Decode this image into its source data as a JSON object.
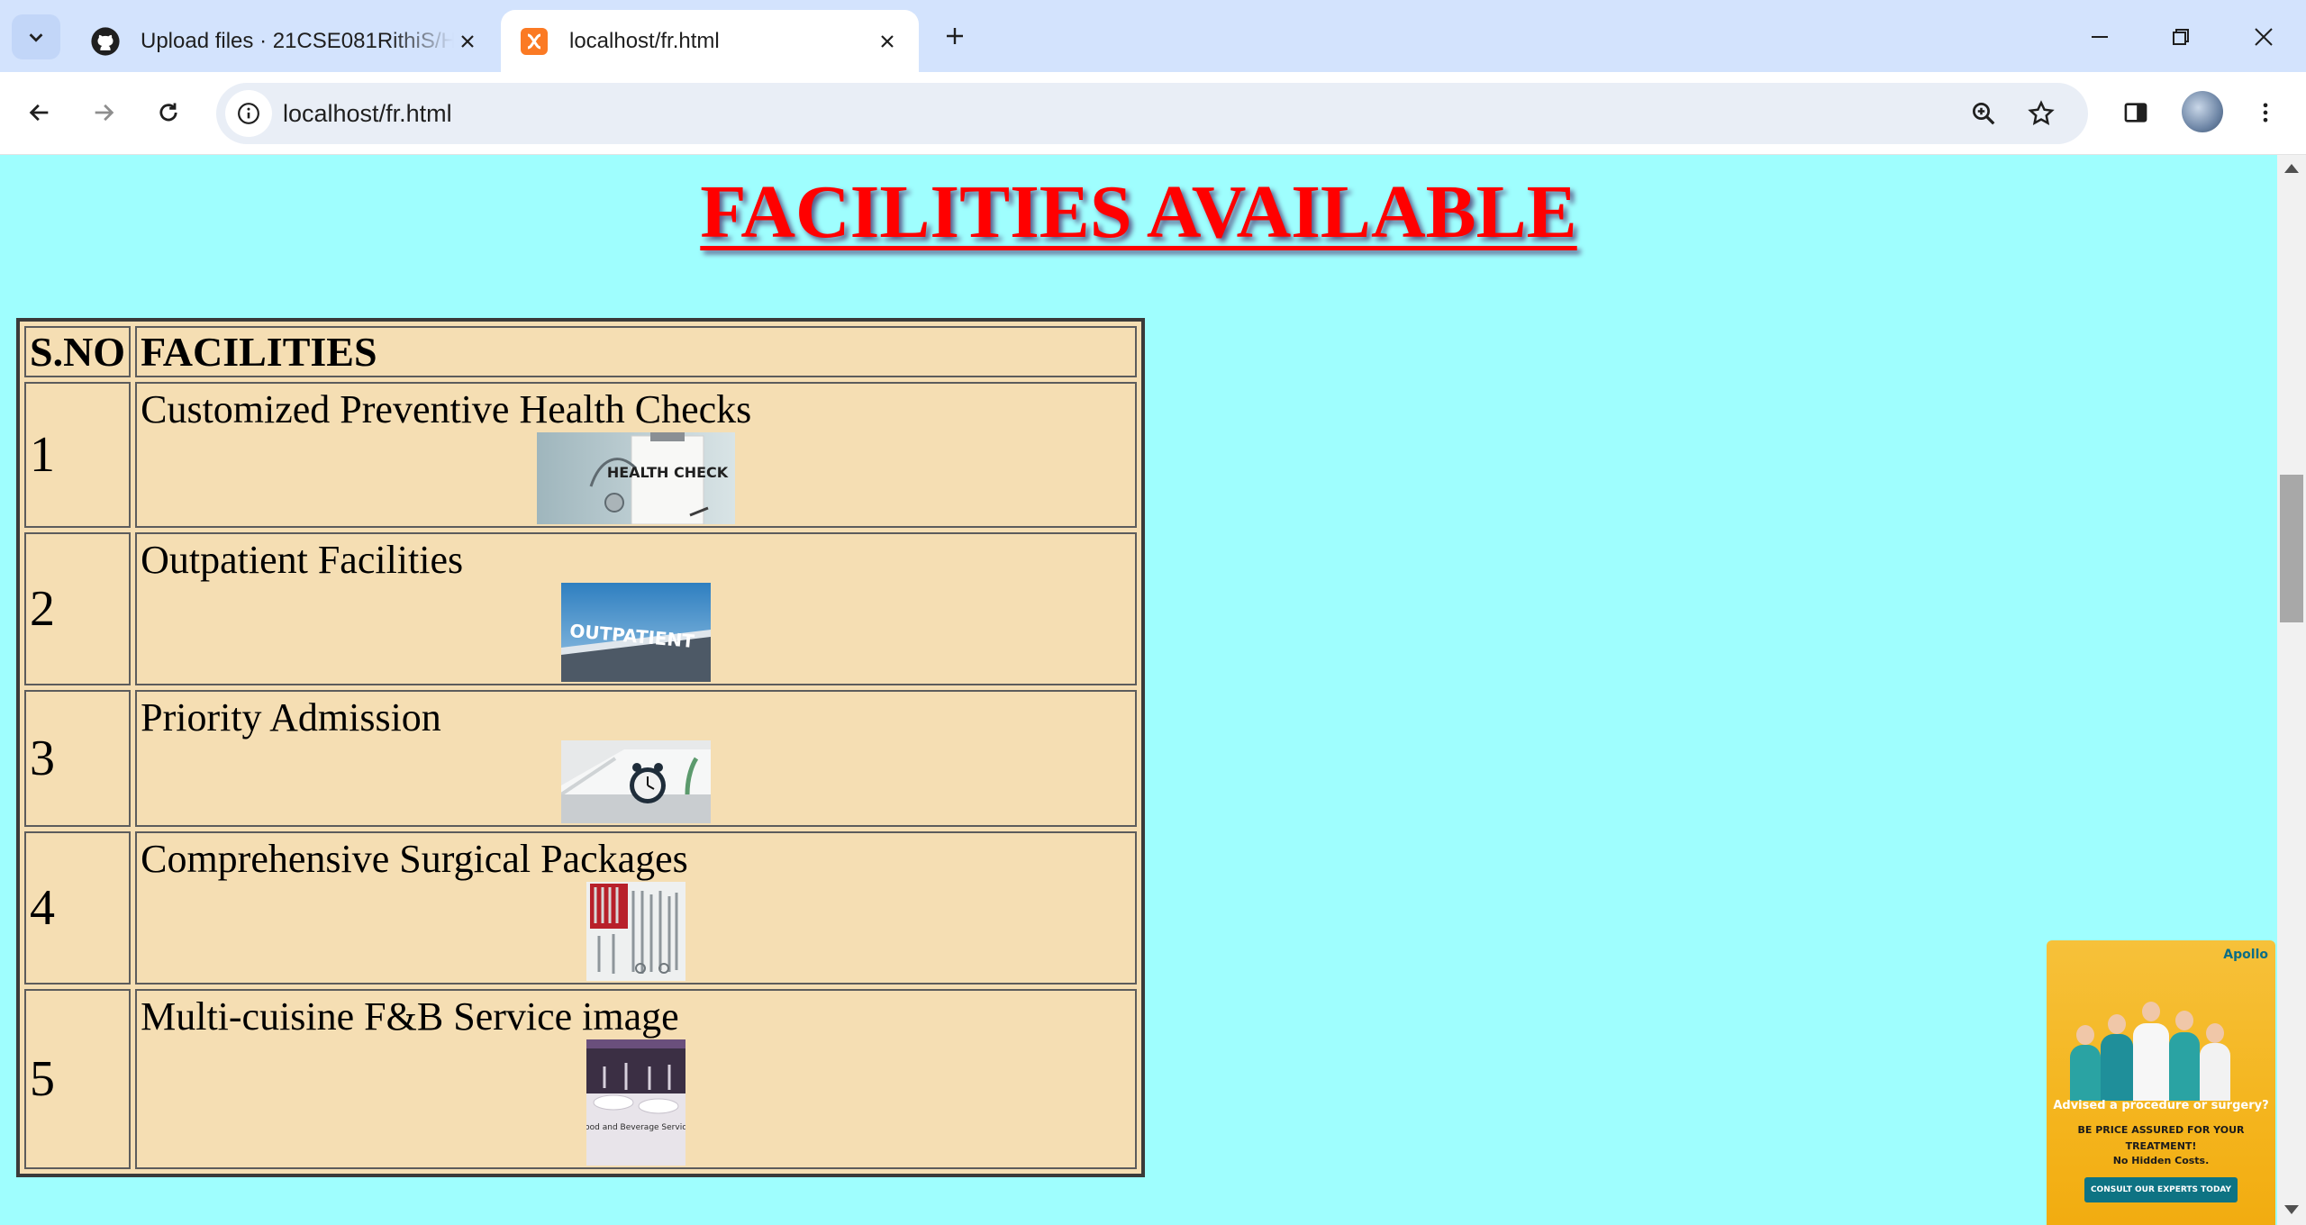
{
  "browser": {
    "tabs": [
      {
        "title": "Upload files · 21CSE081RithiS/H",
        "favicon": "github-icon",
        "active": false
      },
      {
        "title": "localhost/fr.html",
        "favicon": "xampp-icon",
        "active": true
      }
    ],
    "url": "localhost/fr.html"
  },
  "page": {
    "heading": "FACILITIES AVAILABLE",
    "background": "#9ffefe",
    "table_background": "#f5deb3",
    "heading_color": "#ff0000",
    "table": {
      "headers": [
        "S.NO",
        "FACILITIES"
      ],
      "rows": [
        {
          "sno": "1",
          "facility": "Customized Preventive Health Checks",
          "image_text": "HEALTH CHECK"
        },
        {
          "sno": "2",
          "facility": "Outpatient Facilities",
          "image_text": "OUTPATIENT"
        },
        {
          "sno": "3",
          "facility": "Priority Admission",
          "image_text": ""
        },
        {
          "sno": "4",
          "facility": "Comprehensive Surgical Packages",
          "image_text": ""
        },
        {
          "sno": "5",
          "facility": "Multi-cuisine F&B Service image",
          "image_text": "Food and Beverage Service"
        }
      ]
    }
  },
  "ad": {
    "brand": "Apollo",
    "headline": "Advised a procedure or surgery?",
    "subline": "BE PRICE ASSURED FOR YOUR TREATMENT!",
    "note": "No Hidden Costs.",
    "cta": "CONSULT OUR EXPERTS TODAY"
  }
}
